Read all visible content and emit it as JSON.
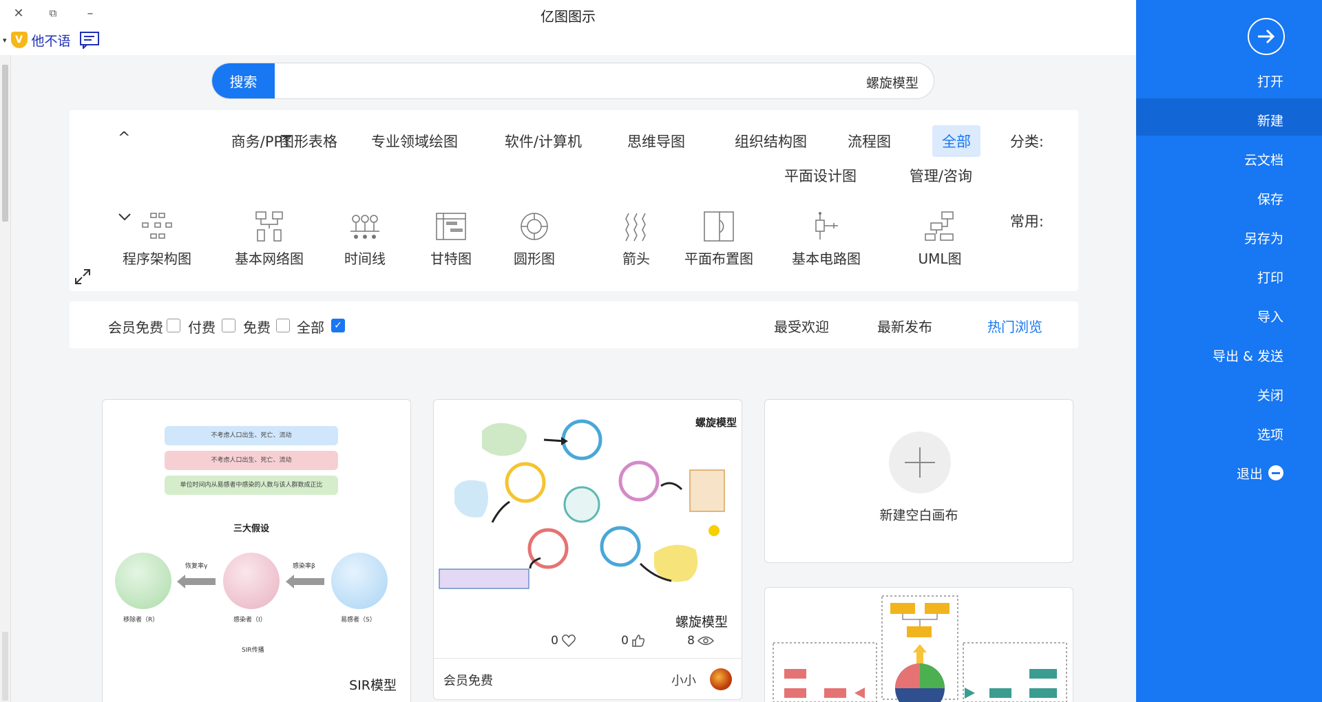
{
  "window": {
    "title": "亿图图示",
    "close_glyph": "✕",
    "restore_glyph": "⧉",
    "minimize_glyph": "–"
  },
  "user": {
    "name": "他不语",
    "vip_glyph": "V",
    "caret": "▾"
  },
  "search": {
    "button_label": "搜索",
    "query": "螺旋模型"
  },
  "categories": {
    "label": "分类:",
    "items": [
      "全部",
      "流程图",
      "组织结构图",
      "思维导图",
      "软件/计算机",
      "专业领域绘图",
      "图形表格",
      "商务/PPT",
      "管理/咨询",
      "平面设计图"
    ],
    "active": "全部",
    "collapse_glyph": "^"
  },
  "common": {
    "label": "常用:",
    "items": [
      {
        "label": "UML图",
        "icon": "uml-icon"
      },
      {
        "label": "基本电路图",
        "icon": "circuit-icon"
      },
      {
        "label": "平面布置图",
        "icon": "floorplan-icon"
      },
      {
        "label": "箭头",
        "icon": "arrow-shape-icon"
      },
      {
        "label": "圆形图",
        "icon": "circular-diagram-icon"
      },
      {
        "label": "甘特图",
        "icon": "gantt-icon"
      },
      {
        "label": "时间线",
        "icon": "timeline-icon"
      },
      {
        "label": "基本网络图",
        "icon": "network-icon"
      },
      {
        "label": "程序架构图",
        "icon": "architecture-icon"
      }
    ],
    "expand_glyph": "⌄"
  },
  "filter": {
    "sort": [
      "热门浏览",
      "最新发布",
      "最受欢迎"
    ],
    "sort_active": "热门浏览",
    "checks": [
      {
        "label": "全部",
        "checked": true
      },
      {
        "label": "免费",
        "checked": false
      },
      {
        "label": "付费",
        "checked": false
      },
      {
        "label": "会员免费",
        "checked": false
      }
    ]
  },
  "cards": {
    "new_blank": {
      "label": "新建空白画布"
    },
    "spiral": {
      "title": "螺旋模型",
      "diagram_title": "螺旋模型",
      "views": "8",
      "likes": "0",
      "favorites": "0",
      "price_label": "会员免费",
      "author": "小小"
    },
    "sir": {
      "title": "SIR模型",
      "heading": "三大假设",
      "assumptions": [
        "不考虑人口出生、死亡、流动",
        "不考虑人口出生、死亡、流动",
        "单位时间内从易感者中感染的人数与该人群数成正比"
      ],
      "nodes": [
        "易感者（S）",
        "感染者（I）",
        "移除者（R）"
      ],
      "arrows": [
        "感染率β",
        "恢复率γ"
      ],
      "footer": "SIR传播"
    }
  },
  "sidebar": {
    "items": [
      "打开",
      "新建",
      "云文档",
      "保存",
      "另存为",
      "打印",
      "导入",
      "导出 & 发送",
      "关闭",
      "选项",
      "退出"
    ],
    "active": "新建"
  },
  "colors": {
    "accent": "#1877f2",
    "sidebar_active": "#1366d6",
    "panel_bg": "#f4f5f7"
  }
}
